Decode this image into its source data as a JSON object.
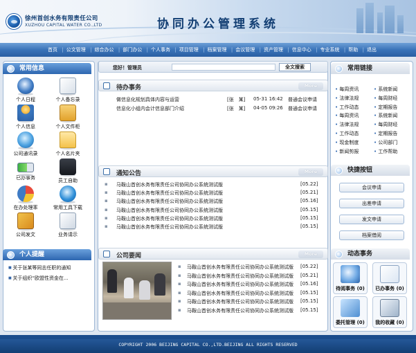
{
  "header": {
    "company_cn": "徐州首创水务有限责任公司",
    "company_en": "XUZHOU CAPITAL WATER CO.,LTD",
    "system_title": "协同办公管理系统"
  },
  "nav": [
    "首页",
    "公文管理",
    "综合办公",
    "部门办公",
    "个人事务",
    "项目管理",
    "档案管理",
    "会议管理",
    "资产管理",
    "信息中心",
    "专业系统",
    "帮助",
    "退出"
  ],
  "left": {
    "common_title": "常用信息",
    "apps": [
      {
        "label": "个人日程",
        "icon": "clock-icon"
      },
      {
        "label": "个人备忘录",
        "icon": "memo-icon"
      },
      {
        "label": "个人信息",
        "icon": "person-icon"
      },
      {
        "label": "个人文件柜",
        "icon": "cabinet-icon"
      },
      {
        "label": "公司通讯录",
        "icon": "contacts-icon"
      },
      {
        "label": "个人名片夹",
        "icon": "folder-icon"
      },
      {
        "label": "已办事务",
        "icon": "battery-icon"
      },
      {
        "label": "员工自助",
        "icon": "bag-icon"
      },
      {
        "label": "在办处理率",
        "icon": "pie-icon"
      },
      {
        "label": "常用工具下载",
        "icon": "download-icon"
      },
      {
        "label": "公司发文",
        "icon": "tools-icon"
      },
      {
        "label": "业务请示",
        "icon": "paper-icon"
      }
    ],
    "remind_title": "个人提醒",
    "reminders": [
      "关于张某等同志任职的通知",
      "关于组织“欧盟性资金在..."
    ]
  },
  "search": {
    "greeting": "您好！管理员",
    "button": "全文搜索"
  },
  "todo": {
    "title": "待办事务",
    "more": "More",
    "rows": [
      {
        "title": "做信息化规划具体内容与运营",
        "person": "[张　某]",
        "time": "05-31 16:42",
        "type": "普通会议申请"
      },
      {
        "title": "信息化小组内会计信息部门介绍",
        "person": "[张　某]",
        "time": "04-05 09:26",
        "type": "普通会议申请"
      }
    ]
  },
  "notice": {
    "title": "通知公告",
    "more": "More",
    "rows": [
      {
        "text": "马鞍山首创水务有限责任公司协同办公系统测试版",
        "date": "[05.22]"
      },
      {
        "text": "马鞍山首创水务有限责任公司协同办公系统测试版",
        "date": "[05.21]"
      },
      {
        "text": "马鞍山首创水务有限责任公司协同办公系统测试版",
        "date": "[05.16]"
      },
      {
        "text": "马鞍山首创水务有限责任公司协同办公系统测试版",
        "date": "[05.15]"
      },
      {
        "text": "马鞍山首创水务有限责任公司协同办公系统测试版",
        "date": "[05.15]"
      },
      {
        "text": "马鞍山首创水务有限责任公司协同办公系统测试版",
        "date": "[05.15]"
      }
    ]
  },
  "news": {
    "title": "公司要闻",
    "more": "More",
    "rows": [
      {
        "text": "马鞍山首创水务有限责任公司协同办公系统测试版",
        "date": "[05.22]"
      },
      {
        "text": "马鞍山首创水务有限责任公司协同办公系统测试版",
        "date": "[05.21]"
      },
      {
        "text": "马鞍山首创水务有限责任公司协同办公系统测试版",
        "date": "[05.16]"
      },
      {
        "text": "马鞍山首创水务有限责任公司协同办公系统测试版",
        "date": "[05.15]"
      },
      {
        "text": "马鞍山首创水务有限责任公司协同办公系统测试版",
        "date": "[05.15]"
      },
      {
        "text": "马鞍山首创水务有限责任公司协同办公系统测试版",
        "date": "[05.15]"
      }
    ]
  },
  "right": {
    "links_title": "常用链接",
    "links": [
      "每周资讯",
      "系统新闻",
      "法律法规",
      "每周财经",
      "工作动态",
      "定期报告",
      "每周资讯",
      "系统新闻",
      "法律法规",
      "每周财经",
      "工作动态",
      "定期报告",
      "现金制度",
      "公司部门",
      "新闻剪报",
      "工作帮助"
    ],
    "quick_title": "快捷按钮",
    "quick": [
      "会议申请",
      "出差申请",
      "发文申请",
      "档案借阅"
    ],
    "dyn_title": "动态事务",
    "dyn": [
      {
        "label": "待阅事务 (0)",
        "icon": "globe-icon"
      },
      {
        "label": "已办事务 (0)",
        "icon": "document-icon"
      },
      {
        "label": "委托管理 (0)",
        "icon": "delegate-icon"
      },
      {
        "label": "我的收藏 (0)",
        "icon": "favorites-icon"
      }
    ]
  },
  "footer": "COPYRIGHT 2006 BEIJING CAPITAL CO.,LTD.BEIJING ALL RIGHTS RESERVED",
  "colors": {
    "primary": "#2d66b0",
    "dark": "#123e73",
    "bg": "#dfe7f1"
  }
}
